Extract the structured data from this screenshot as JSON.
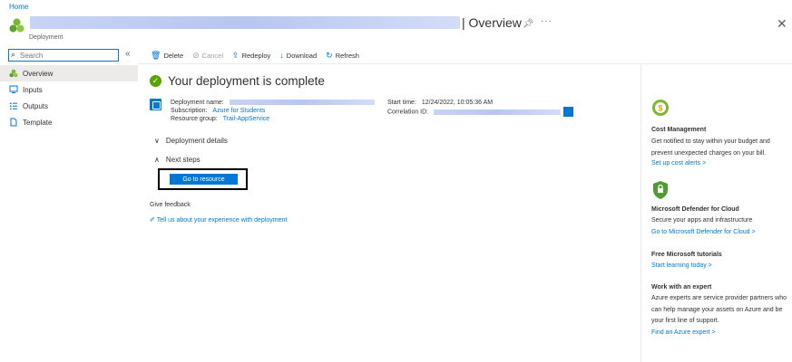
{
  "breadcrumb": {
    "home": "Home"
  },
  "header": {
    "title": "| Overview",
    "subtitle": "Deployment",
    "pin_icon": "pin-icon",
    "more_icon": "ellipsis-icon",
    "close_icon": "close-icon"
  },
  "sidebar": {
    "search_placeholder": "Search",
    "items": [
      {
        "label": "Overview",
        "icon": "overview-icon",
        "active": true
      },
      {
        "label": "Inputs",
        "icon": "inputs-icon"
      },
      {
        "label": "Outputs",
        "icon": "outputs-icon"
      },
      {
        "label": "Template",
        "icon": "template-icon"
      }
    ]
  },
  "toolbar": {
    "delete": "Delete",
    "cancel": "Cancel",
    "redeploy": "Redeploy",
    "download": "Download",
    "refresh": "Refresh"
  },
  "main": {
    "status_title": "Your deployment is complete",
    "deployment_name_label": "Deployment name:",
    "subscription_label": "Subscription:",
    "subscription_value": "Azure for Students",
    "resource_group_label": "Resource group:",
    "resource_group_value": "Trail-AppService",
    "start_time_label": "Start time:",
    "start_time_value": "12/24/2022, 10:05:36 AM",
    "correlation_label": "Correlation ID:",
    "deployment_details": "Deployment details",
    "next_steps": "Next steps",
    "go_to_resource": "Go to resource",
    "give_feedback": "Give feedback",
    "feedback_link": "Tell us about your experience with deployment"
  },
  "right_panel": {
    "cost": {
      "title": "Cost Management",
      "text": "Get notified to stay within your budget and prevent unexpected charges on your bill.",
      "link": "Set up cost alerts >"
    },
    "defender": {
      "title": "Microsoft Defender for Cloud",
      "text": "Secure your apps and infrastructure",
      "link": "Go to Microsoft Defender for Cloud >"
    },
    "tutorials": {
      "title": "Free Microsoft tutorials",
      "link": "Start learning today >"
    },
    "expert": {
      "title": "Work with an expert",
      "text": "Azure experts are service provider partners who can help manage your assets on Azure and be your first line of support.",
      "link": "Find an Azure expert >"
    }
  },
  "colors": {
    "accent": "#0078d4",
    "success": "#57a300",
    "defender": "#4f9c32"
  }
}
